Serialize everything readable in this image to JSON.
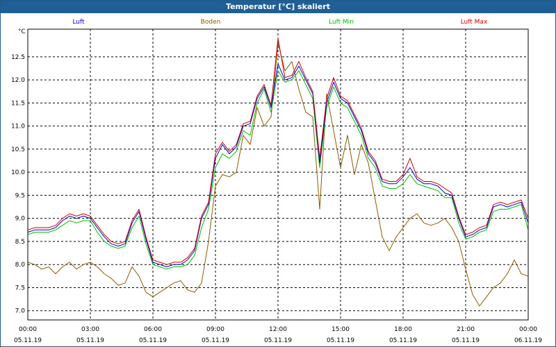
{
  "window": {
    "title": "Temperatur [°C] skaliert"
  },
  "colors": {
    "titlebar": "#1f5f96",
    "luft": "#0000cc",
    "boden": "#8b5a00",
    "luft_min": "#00bb00",
    "luft_max": "#cc0000",
    "grid": "#000000"
  },
  "chart_data": {
    "type": "line",
    "title": "Temperatur [°C] skaliert",
    "ylabel": "°C",
    "xlabel": "",
    "ylim": [
      6.8,
      13.1
    ],
    "xlim": [
      0,
      1440
    ],
    "grid": true,
    "legend_position": "top",
    "y_ticks": [
      "7.0",
      "7.5",
      "8.0",
      "8.5",
      "9.0",
      "9.5",
      "10.0",
      "10.5",
      "11.0",
      "11.5",
      "12.0",
      "12.5"
    ],
    "x_ticks": [
      {
        "time": "00:00",
        "date": "05.11.19"
      },
      {
        "time": "03:00",
        "date": "05.11.19"
      },
      {
        "time": "06:00",
        "date": "05.11.19"
      },
      {
        "time": "09:00",
        "date": "05.11.19"
      },
      {
        "time": "12:00",
        "date": "05.11.19"
      },
      {
        "time": "15:00",
        "date": "05.11.19"
      },
      {
        "time": "18:00",
        "date": "05.11.19"
      },
      {
        "time": "21:00",
        "date": "05.11.19"
      },
      {
        "time": "00:00",
        "date": "06.11.19"
      }
    ],
    "series": [
      {
        "name": "Luft",
        "x": [
          0,
          20,
          40,
          60,
          80,
          100,
          120,
          140,
          160,
          180,
          200,
          220,
          240,
          260,
          280,
          300,
          320,
          340,
          360,
          380,
          400,
          420,
          440,
          460,
          480,
          500,
          520,
          540,
          560,
          580,
          600,
          620,
          640,
          660,
          680,
          700,
          720,
          740,
          760,
          780,
          800,
          820,
          840,
          860,
          880,
          900,
          920,
          940,
          960,
          980,
          1000,
          1020,
          1040,
          1060,
          1080,
          1100,
          1120,
          1140,
          1160,
          1180,
          1200,
          1220,
          1240,
          1260,
          1280,
          1300,
          1320,
          1340,
          1360,
          1380,
          1400,
          1420,
          1440
        ],
        "y": [
          8.7,
          8.75,
          8.75,
          8.75,
          8.8,
          8.95,
          9.05,
          9.0,
          9.05,
          9.0,
          8.8,
          8.6,
          8.45,
          8.4,
          8.45,
          8.9,
          9.15,
          8.55,
          8.05,
          8.0,
          7.95,
          8.0,
          8.0,
          8.1,
          8.3,
          9.0,
          9.3,
          10.3,
          10.6,
          10.4,
          10.55,
          11.0,
          11.05,
          11.6,
          11.85,
          11.4,
          12.35,
          12.0,
          12.05,
          12.3,
          12.0,
          11.7,
          10.2,
          11.5,
          11.95,
          11.6,
          11.5,
          11.2,
          10.9,
          10.4,
          10.2,
          9.8,
          9.75,
          9.75,
          9.9,
          10.1,
          9.85,
          9.75,
          9.75,
          9.7,
          9.55,
          9.5,
          9.0,
          8.6,
          8.65,
          8.75,
          8.8,
          9.25,
          9.3,
          9.25,
          9.3,
          9.35,
          8.9
        ]
      },
      {
        "name": "Boden",
        "x": [
          0,
          20,
          40,
          60,
          80,
          100,
          120,
          140,
          160,
          180,
          200,
          220,
          240,
          260,
          280,
          300,
          320,
          340,
          360,
          380,
          400,
          420,
          440,
          460,
          480,
          500,
          520,
          540,
          560,
          580,
          600,
          620,
          640,
          660,
          680,
          700,
          720,
          740,
          760,
          780,
          800,
          820,
          840,
          860,
          880,
          900,
          920,
          940,
          960,
          980,
          1000,
          1020,
          1040,
          1060,
          1080,
          1100,
          1120,
          1140,
          1160,
          1180,
          1200,
          1220,
          1240,
          1260,
          1280,
          1300,
          1320,
          1340,
          1360,
          1380,
          1400,
          1420,
          1440
        ],
        "y": [
          8.05,
          8.0,
          7.9,
          7.95,
          7.8,
          7.95,
          8.05,
          7.9,
          8.0,
          8.05,
          7.95,
          7.8,
          7.7,
          7.55,
          7.6,
          7.95,
          7.75,
          7.4,
          7.3,
          7.4,
          7.5,
          7.6,
          7.65,
          7.45,
          7.4,
          7.6,
          8.5,
          9.7,
          9.95,
          9.9,
          10.0,
          10.8,
          10.6,
          11.4,
          11.0,
          11.2,
          12.8,
          12.2,
          12.4,
          11.8,
          11.3,
          11.2,
          9.2,
          11.7,
          10.9,
          10.1,
          10.8,
          9.95,
          10.6,
          10.2,
          9.4,
          8.6,
          8.3,
          8.6,
          8.8,
          9.0,
          9.1,
          8.9,
          8.85,
          8.9,
          9.0,
          8.8,
          8.5,
          7.9,
          7.35,
          7.1,
          7.3,
          7.5,
          7.6,
          7.8,
          8.1,
          7.8,
          7.75
        ]
      },
      {
        "name": "Luft Min",
        "x": [
          0,
          20,
          40,
          60,
          80,
          100,
          120,
          140,
          160,
          180,
          200,
          220,
          240,
          260,
          280,
          300,
          320,
          340,
          360,
          380,
          400,
          420,
          440,
          460,
          480,
          500,
          520,
          540,
          560,
          580,
          600,
          620,
          640,
          660,
          680,
          700,
          720,
          740,
          760,
          780,
          800,
          820,
          840,
          860,
          880,
          900,
          920,
          940,
          960,
          980,
          1000,
          1020,
          1040,
          1060,
          1080,
          1100,
          1120,
          1140,
          1160,
          1180,
          1200,
          1220,
          1240,
          1260,
          1280,
          1300,
          1320,
          1340,
          1360,
          1380,
          1400,
          1420,
          1440
        ],
        "y": [
          8.65,
          8.7,
          8.7,
          8.7,
          8.75,
          8.85,
          8.95,
          8.9,
          8.95,
          8.95,
          8.7,
          8.5,
          8.4,
          8.35,
          8.4,
          8.8,
          9.05,
          8.45,
          8.0,
          7.95,
          7.9,
          7.95,
          7.95,
          8.0,
          8.2,
          8.8,
          9.2,
          10.1,
          10.4,
          10.3,
          10.45,
          10.9,
          10.8,
          11.5,
          11.8,
          11.3,
          12.2,
          11.95,
          12.0,
          12.2,
          11.9,
          11.6,
          10.1,
          11.4,
          11.85,
          11.5,
          11.4,
          11.1,
          10.8,
          10.3,
          10.1,
          9.7,
          9.65,
          9.65,
          9.75,
          9.95,
          9.75,
          9.7,
          9.65,
          9.6,
          9.45,
          9.45,
          8.9,
          8.55,
          8.6,
          8.7,
          8.75,
          9.15,
          9.2,
          9.2,
          9.25,
          9.3,
          8.75
        ]
      },
      {
        "name": "Luft Max",
        "x": [
          0,
          20,
          40,
          60,
          80,
          100,
          120,
          140,
          160,
          180,
          200,
          220,
          240,
          260,
          280,
          300,
          320,
          340,
          360,
          380,
          400,
          420,
          440,
          460,
          480,
          500,
          520,
          540,
          560,
          580,
          600,
          620,
          640,
          660,
          680,
          700,
          720,
          740,
          760,
          780,
          800,
          820,
          840,
          860,
          880,
          900,
          920,
          940,
          960,
          980,
          1000,
          1020,
          1040,
          1060,
          1080,
          1100,
          1120,
          1140,
          1160,
          1180,
          1200,
          1220,
          1240,
          1260,
          1280,
          1300,
          1320,
          1340,
          1360,
          1380,
          1400,
          1420,
          1440
        ],
        "y": [
          8.75,
          8.8,
          8.8,
          8.8,
          8.85,
          9.0,
          9.1,
          9.05,
          9.1,
          9.05,
          8.85,
          8.65,
          8.5,
          8.45,
          8.5,
          8.95,
          9.2,
          8.6,
          8.1,
          8.05,
          8.0,
          8.05,
          8.05,
          8.15,
          8.35,
          9.05,
          9.35,
          10.4,
          10.65,
          10.45,
          10.6,
          11.05,
          11.1,
          11.65,
          11.9,
          11.45,
          12.9,
          12.05,
          12.1,
          12.4,
          12.05,
          11.75,
          10.3,
          11.6,
          12.05,
          11.65,
          11.55,
          11.25,
          10.95,
          10.45,
          10.25,
          9.85,
          9.8,
          9.8,
          9.95,
          10.3,
          9.9,
          9.8,
          9.8,
          9.75,
          9.65,
          9.55,
          9.05,
          8.65,
          8.7,
          8.8,
          8.85,
          9.3,
          9.35,
          9.3,
          9.35,
          9.4,
          9.0
        ]
      }
    ]
  }
}
